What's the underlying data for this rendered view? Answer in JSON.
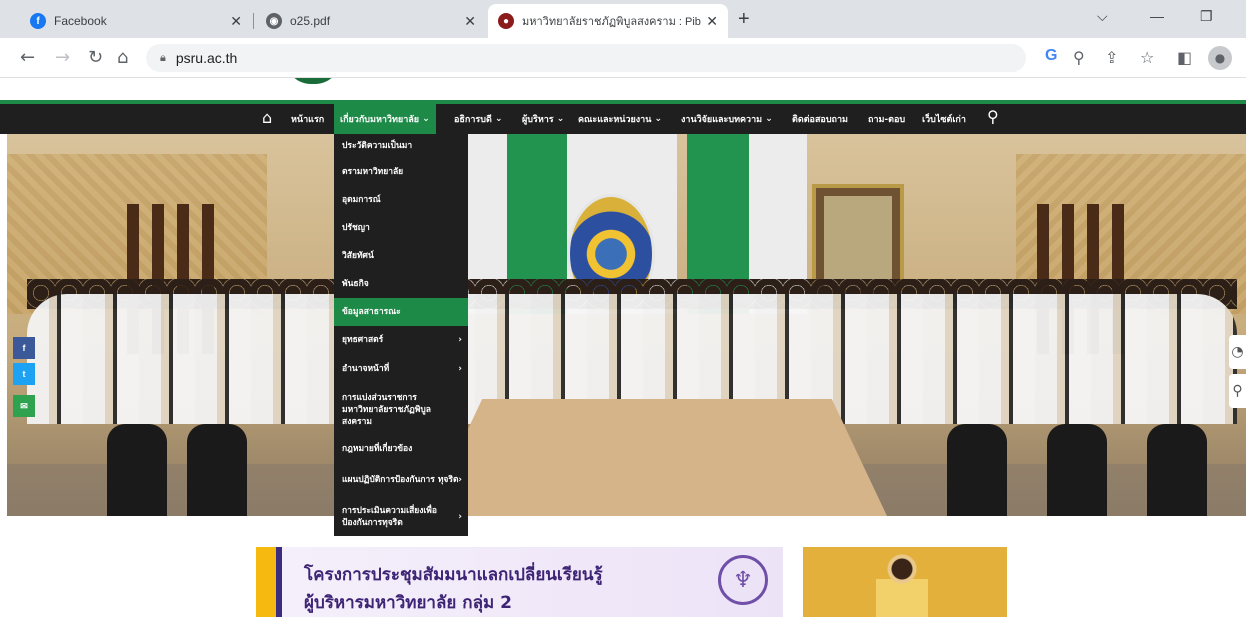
{
  "browser": {
    "tabs": [
      {
        "title": "Facebook",
        "icon": "facebook-icon",
        "color": "#1877f2"
      },
      {
        "title": "o25.pdf",
        "icon": "globe-icon",
        "color": "#5f6368"
      },
      {
        "title": "มหาวิทยาลัยราชภัฏพิบูลสงคราม : Pib",
        "icon": "university-favicon",
        "color": "#8a1c1c"
      }
    ],
    "url": "psru.ac.th"
  },
  "site": {
    "accent_color": "#1e8a48",
    "nav": [
      {
        "label": "หน้าแรก"
      },
      {
        "label": "เกี่ยวกับมหาวิทยาลัย",
        "caret": "⌄"
      },
      {
        "label": "อธิการบดี",
        "caret": "⌄"
      },
      {
        "label": "ผู้บริหาร",
        "caret": "⌄"
      },
      {
        "label": "คณะและหน่วยงาน",
        "caret": "⌄"
      },
      {
        "label": "งานวิจัยและบทความ",
        "caret": "⌄"
      },
      {
        "label": "ติดต่อสอบถาม"
      },
      {
        "label": "ถาม-ตอบ"
      },
      {
        "label": "เว็บไซต์เก่า"
      }
    ],
    "dropdown": [
      {
        "label": "ประวัติความเป็นมา"
      },
      {
        "label": "ตรามหาวิทยาลัย"
      },
      {
        "label": "อุดมการณ์"
      },
      {
        "label": "ปรัชญา"
      },
      {
        "label": "วิสัยทัศน์"
      },
      {
        "label": "พันธกิจ"
      },
      {
        "label": "ข้อมูลสาธารณะ"
      },
      {
        "label": "ยุทธศาสตร์",
        "chevron": "›"
      },
      {
        "label": "อำนาจหน้าที่",
        "chevron": "›"
      },
      {
        "label": "การแบ่งส่วนราชการ มหาวิทยาลัยราชภัฏพิบูล สงคราม"
      },
      {
        "label": "กฎหมายที่เกี่ยวข้อง"
      },
      {
        "label": "แผนปฏิบัติการป้องกันการ ทุจริต",
        "chevron": "›"
      },
      {
        "label": "การประเมินความเสี่ยงเพื่อ ป้องกันการทุจริต",
        "chevron": "›"
      }
    ],
    "social": [
      {
        "label": "f",
        "color": "#3b5998",
        "icon": "facebook-share-icon"
      },
      {
        "label": "t",
        "color": "#1da1f2",
        "icon": "twitter-share-icon"
      },
      {
        "label": "✉",
        "color": "#2fa24f",
        "icon": "email-share-icon"
      }
    ],
    "banner": {
      "line1": "โครงการประชุมสัมมนาแลกเปลี่ยนเรียนรู้",
      "line2": "ผู้บริหารมหาวิทยาลัย กลุ่ม 2"
    }
  }
}
